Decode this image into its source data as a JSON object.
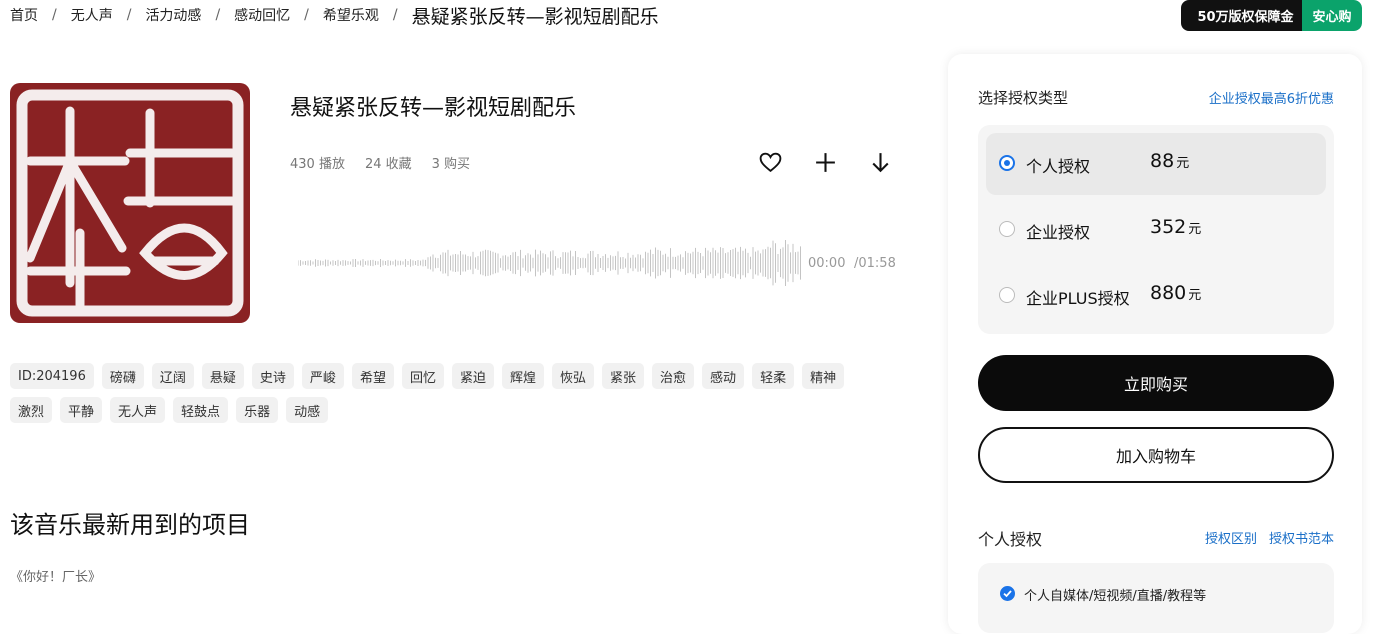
{
  "breadcrumb": {
    "items": [
      "首页",
      "无人声",
      "活力动感",
      "感动回忆",
      "希望乐观"
    ],
    "separator": "/",
    "current": "悬疑紧张反转—影视短剧配乐"
  },
  "badge": {
    "left": "50万版权保障金",
    "right": "安心购"
  },
  "track": {
    "title": "悬疑紧张反转—影视短剧配乐",
    "plays": "430 播放",
    "favorites": "24 收藏",
    "purchases": "3 购买",
    "time_current": "00:00",
    "time_total": "/01:58",
    "cover_color": "#8a2223"
  },
  "actions": {
    "favorite_icon": "heart-icon",
    "add_icon": "plus-icon",
    "download_icon": "download-arrow-icon"
  },
  "tags": [
    "ID:204196",
    "磅礴",
    "辽阔",
    "悬疑",
    "史诗",
    "严峻",
    "希望",
    "回忆",
    "紧迫",
    "辉煌",
    "恢弘",
    "紧张",
    "治愈",
    "感动",
    "轻柔",
    "精神",
    "激烈",
    "平静",
    "无人声",
    "轻鼓点",
    "乐器",
    "动感"
  ],
  "projects": {
    "heading": "该音乐最新用到的项目",
    "items": [
      "《你好！厂长》"
    ]
  },
  "license": {
    "heading": "选择授权类型",
    "promo_link": "企业授权最高6折优惠",
    "options": [
      {
        "name": "个人授权",
        "price": "88",
        "unit": "元",
        "selected": true
      },
      {
        "name": "企业授权",
        "price": "352",
        "unit": "元",
        "selected": false
      },
      {
        "name": "企业PLUS授权",
        "price": "880",
        "unit": "元",
        "selected": false
      }
    ],
    "buy_label": "立即购买",
    "cart_label": "加入购物车",
    "section2": {
      "title": "个人授权",
      "link_diff": "授权区别",
      "link_sample": "授权书范本",
      "usage": "个人自媒体/短视频/直播/教程等"
    }
  },
  "colors": {
    "accent": "#1a73e8",
    "brand_green": "#0ba36b",
    "link": "#1a6fc8"
  }
}
